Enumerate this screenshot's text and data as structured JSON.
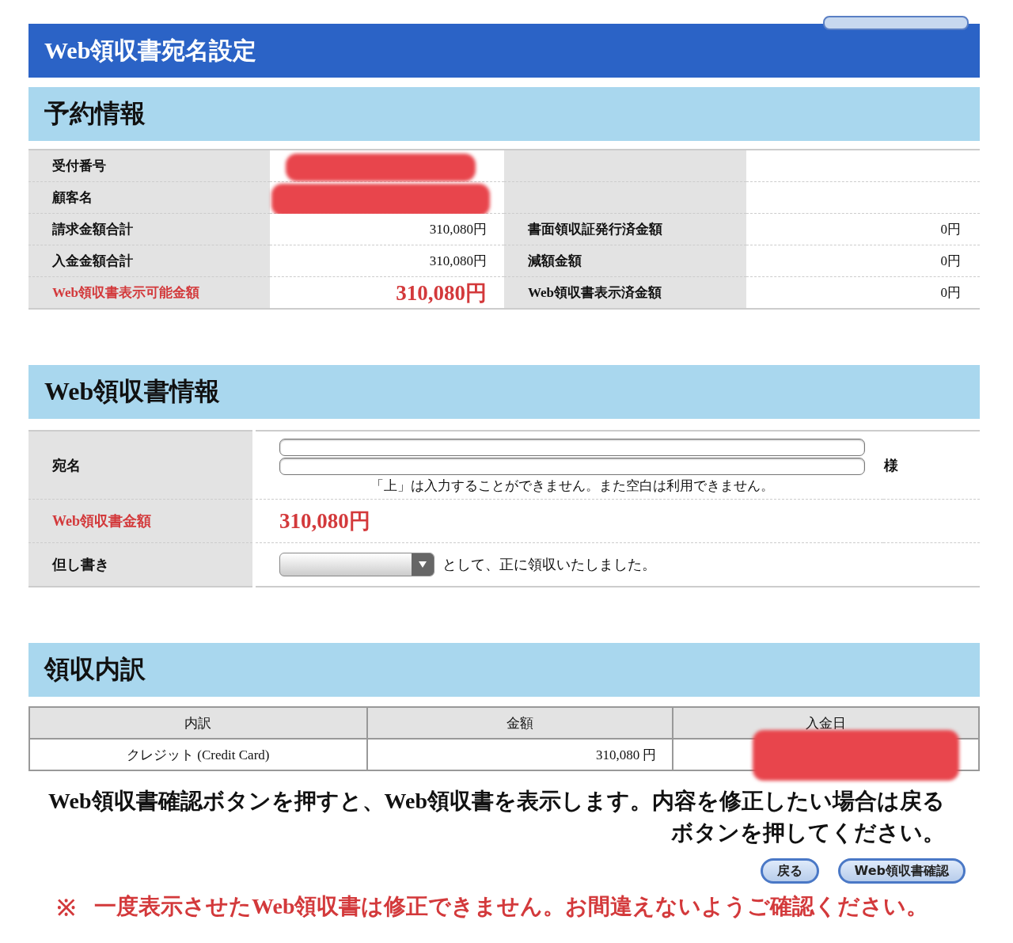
{
  "page_title": "Web領収書宛名設定",
  "reservation": {
    "heading": "予約情報",
    "rows": [
      {
        "label": "受付番号",
        "redacted": true,
        "emphasis": false
      },
      {
        "label": "顧客名",
        "redacted": true,
        "emphasis": false
      },
      {
        "label": "請求金額合計",
        "value": "310,080円",
        "redacted": false,
        "emphasis": false,
        "label_2": "書面領収証発行済金額",
        "value_2": "0円"
      },
      {
        "label": "入金金額合計",
        "value": "310,080円",
        "redacted": false,
        "emphasis": false,
        "label_2": "減額金額",
        "value_2": "0円"
      },
      {
        "label": "Web領収書表示可能金額",
        "value": "310,080円",
        "redacted": false,
        "emphasis": true,
        "label_2": "Web領収書表示済金額",
        "value_2": "0円"
      }
    ]
  },
  "receipt_info": {
    "heading": "Web領収書情報",
    "rows": [
      {
        "kind": "name",
        "label": "宛名",
        "note": "「上」は入力することができません。また空白は利用できません。",
        "suffix": "様"
      },
      {
        "kind": "amount",
        "label": "Web領収書金額",
        "value": "310,080円"
      },
      {
        "kind": "proviso",
        "label": "但し書き",
        "suffix": "として、正に領収いたしました。"
      }
    ]
  },
  "breakdown": {
    "heading": "領収内訳",
    "columns": [
      "内訳",
      "金額",
      "入金日"
    ],
    "rows": [
      [
        {
          "text": "クレジット (Credit Card)",
          "redacted": false
        },
        {
          "text": "310,080 円",
          "redacted": false
        },
        {
          "redacted": true
        }
      ]
    ]
  },
  "instructions": "Web領収書確認ボタンを押すと、Web領収書を表示します。内容を修正したい場合は戻るボタンを押してください。",
  "buttons": [
    "戻る",
    "Web領収書確認"
  ],
  "warning": {
    "mark": "※",
    "text": "一度表示させたWeb領収書は修正できません。お間違えないようご確認ください。"
  }
}
